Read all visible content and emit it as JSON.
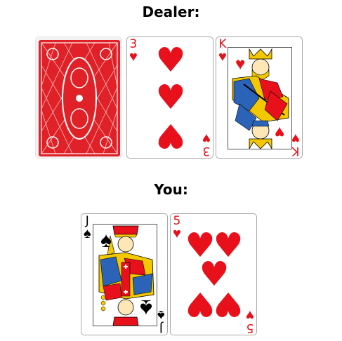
{
  "dealer": {
    "title": "Dealer:",
    "cards": [
      {
        "face_down": true,
        "back_color": "#e02127"
      },
      {
        "rank": "3",
        "suit": "hearts",
        "suit_symbol": "♥",
        "color": "#e8101a"
      },
      {
        "rank": "K",
        "suit": "hearts",
        "suit_symbol": "♥",
        "color": "#e8101a"
      }
    ]
  },
  "player": {
    "title": "You:",
    "cards": [
      {
        "rank": "J",
        "suit": "spades",
        "suit_symbol": "♠",
        "color": "#000000"
      },
      {
        "rank": "5",
        "suit": "hearts",
        "suit_symbol": "♥",
        "color": "#e8101a"
      }
    ]
  }
}
